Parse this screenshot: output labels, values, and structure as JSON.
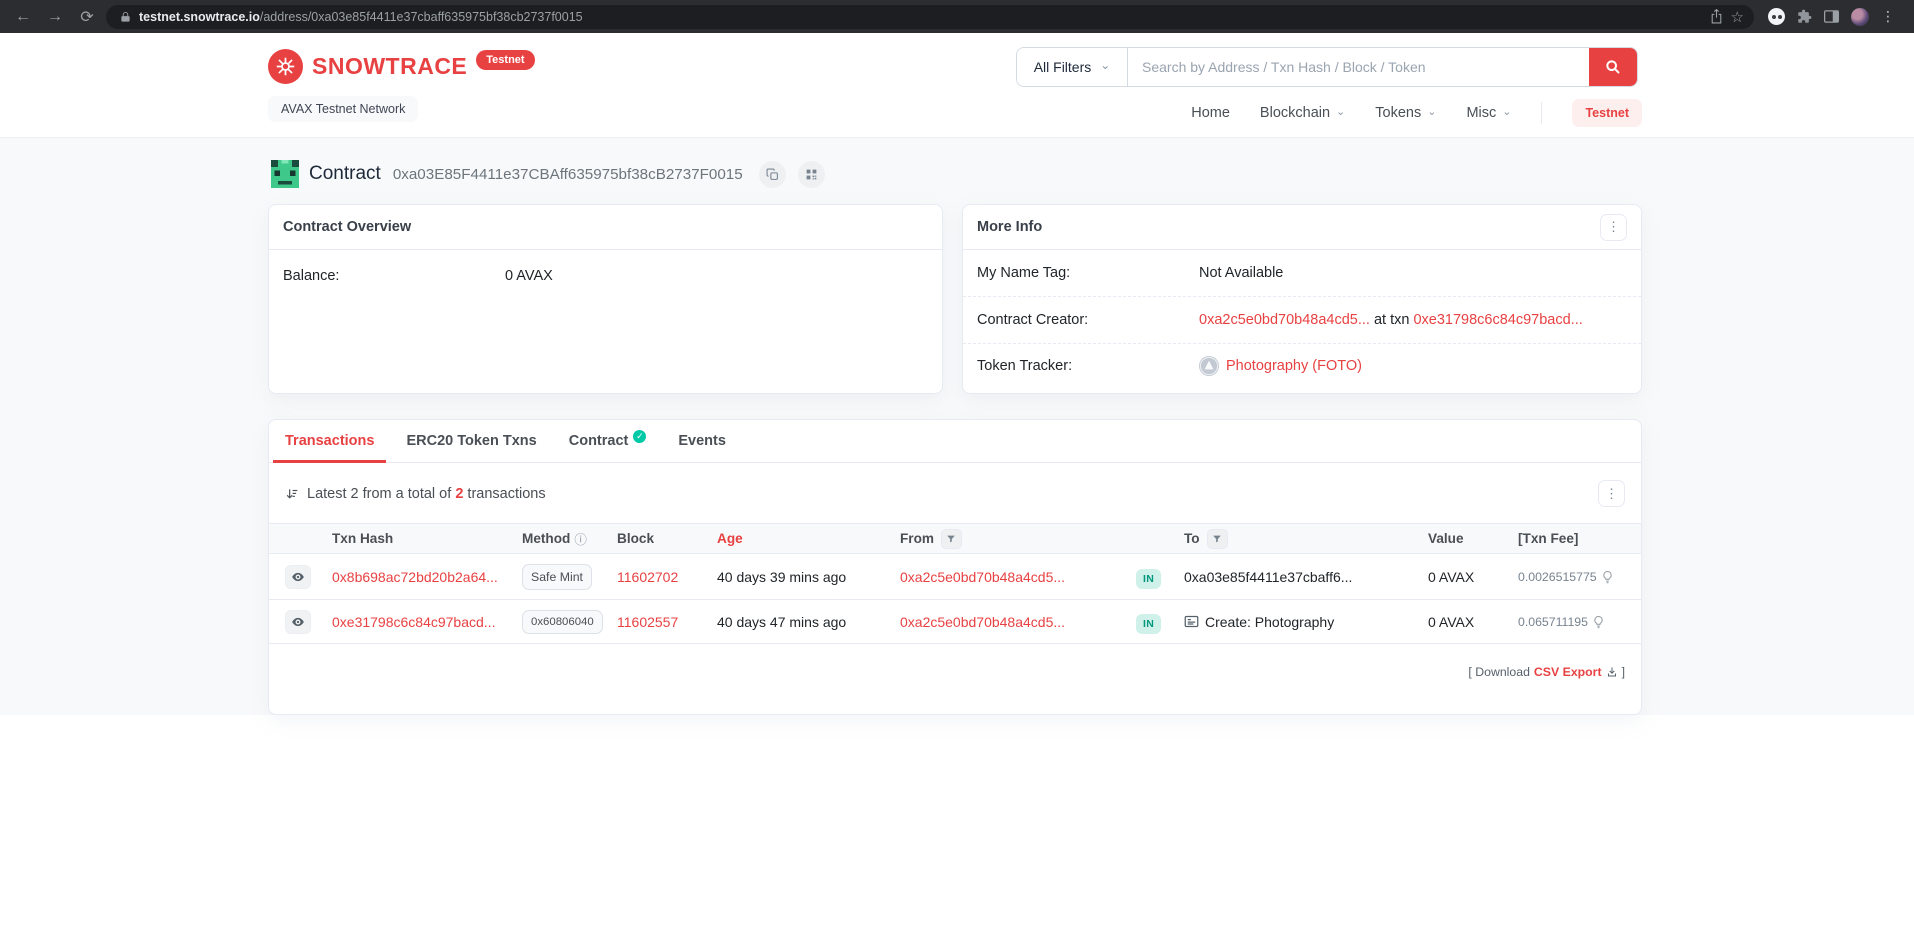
{
  "browser": {
    "host": "testnet.snowtrace.io",
    "path": "/address/0xa03e85f4411e37cbaff635975bf38cb2737f0015"
  },
  "icons": {
    "back": "←",
    "forward": "→",
    "reload": "⟳",
    "star": "☆",
    "kebab": "⋮",
    "chevron": "⌄",
    "info": "ⓘ",
    "check": "✓"
  },
  "header": {
    "brand": "SNOWTRACE",
    "brand_badge": "Testnet",
    "network_badge": "AVAX Testnet Network",
    "search": {
      "filter_label": "All Filters",
      "placeholder": "Search by Address / Txn Hash / Block / Token"
    },
    "nav": [
      {
        "label": "Home"
      },
      {
        "label": "Blockchain"
      },
      {
        "label": "Tokens"
      },
      {
        "label": "Misc"
      }
    ],
    "testnet_button": "Testnet"
  },
  "page": {
    "title": "Contract",
    "address": "0xa03E85F4411e37CBAff635975bf38cB2737F0015"
  },
  "overview_card": {
    "title": "Contract Overview",
    "balance_label": "Balance:",
    "balance_value": "0 AVAX"
  },
  "more_info_card": {
    "title": "More Info",
    "name_tag_label": "My Name Tag:",
    "name_tag_value": "Not Available",
    "creator_label": "Contract Creator:",
    "creator_address": "0xa2c5e0bd70b48a4cd5...",
    "creator_mid": " at txn ",
    "creator_txn": "0xe31798c6c84c97bacd...",
    "tracker_label": "Token Tracker:",
    "tracker_value": "Photography (FOTO)"
  },
  "tabs": [
    {
      "label": "Transactions"
    },
    {
      "label": "ERC20 Token Txns"
    },
    {
      "label": "Contract"
    },
    {
      "label": "Events"
    }
  ],
  "transactions": {
    "summary_prefix": "Latest 2 from a total of ",
    "summary_count": "2",
    "summary_suffix": " transactions",
    "columns": [
      "Txn Hash",
      "Method",
      "Block",
      "Age",
      "From",
      "To",
      "Value",
      "[Txn Fee]"
    ],
    "rows": [
      {
        "txn_hash": "0x8b698ac72bd20b2a64...",
        "method": "Safe Mint",
        "block": "11602702",
        "age": "40 days 39 mins ago",
        "from": "0xa2c5e0bd70b48a4cd5...",
        "direction": "IN",
        "to": "0xa03e85f4411e37cbaff6...",
        "value": "0 AVAX",
        "fee": "0.0026515775"
      },
      {
        "txn_hash": "0xe31798c6c84c97bacd...",
        "method": "0x60806040",
        "block": "11602557",
        "age": "40 days 47 mins ago",
        "from": "0xa2c5e0bd70b48a4cd5...",
        "direction": "IN",
        "to": "Create: Photography",
        "value": "0 AVAX",
        "fee": "0.065711195"
      }
    ],
    "footer": {
      "prefix": "[ Download",
      "link": "CSV Export",
      "suffix": "]"
    }
  },
  "colors": {
    "brand_red": "#e84142",
    "link_red": "#e84142",
    "in_badge_bg": "#cff1e9",
    "in_badge_text": "#02977e",
    "page_bg": "#f8f9fa"
  }
}
